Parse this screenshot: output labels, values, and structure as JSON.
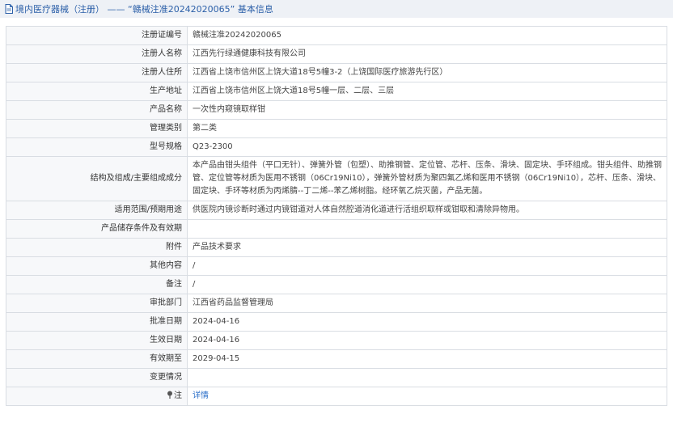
{
  "header": {
    "title": "境内医疗器械（注册） —— “赣械注准20242020065” 基本信息",
    "icon": "document-icon"
  },
  "rows": [
    {
      "label": "注册证编号",
      "value": "赣械注准20242020065"
    },
    {
      "label": "注册人名称",
      "value": "江西先行绿通健康科技有限公司"
    },
    {
      "label": "注册人住所",
      "value": "江西省上饶市信州区上饶大道18号5幢3-2（上饶国际医疗旅游先行区）"
    },
    {
      "label": "生产地址",
      "value": "江西省上饶市信州区上饶大道18号5幢一层、二层、三层"
    },
    {
      "label": "产品名称",
      "value": "一次性内窥镜取样钳"
    },
    {
      "label": "管理类别",
      "value": "第二类"
    },
    {
      "label": "型号规格",
      "value": "Q23-2300"
    },
    {
      "label": "结构及组成/主要组成成分",
      "value": "本产品由钳头组件（平口无针）、弹簧外管（包塑）、助推钢管、定位管、芯杆、压条、滑块、固定块、手环组成。钳头组件、助推钢管、定位管等材质为医用不锈钢（06Cr19Ni10），弹簧外管材质为聚四氟乙烯和医用不锈钢（06Cr19Ni10），芯杆、压条、滑块、固定块、手环等材质为丙烯腈--丁二烯--苯乙烯树脂。经环氧乙烷灭菌，产品无菌。"
    },
    {
      "label": "适用范围/预期用途",
      "value": "供医院内镜诊断时通过内镜钳道对人体自然腔道消化道进行活组织取样或钳取和清除异物用。"
    },
    {
      "label": "产品储存条件及有效期",
      "value": ""
    },
    {
      "label": "附件",
      "value": "产品技术要求"
    },
    {
      "label": "其他内容",
      "value": "/"
    },
    {
      "label": "备注",
      "value": "/"
    },
    {
      "label": "审批部门",
      "value": "江西省药品监督管理局"
    },
    {
      "label": "批准日期",
      "value": "2024-04-16"
    },
    {
      "label": "生效日期",
      "value": "2024-04-16"
    },
    {
      "label": "有效期至",
      "value": "2029-04-15"
    },
    {
      "label": "变更情况",
      "value": ""
    },
    {
      "label": "注",
      "value": "详情",
      "icon": "pin-icon"
    }
  ],
  "colors": {
    "title_bg": "#eef1f6",
    "title_text": "#2b5fa8",
    "border": "#d9dde3",
    "label_bg": "#f7f8fa",
    "link": "#2b6fc9"
  }
}
